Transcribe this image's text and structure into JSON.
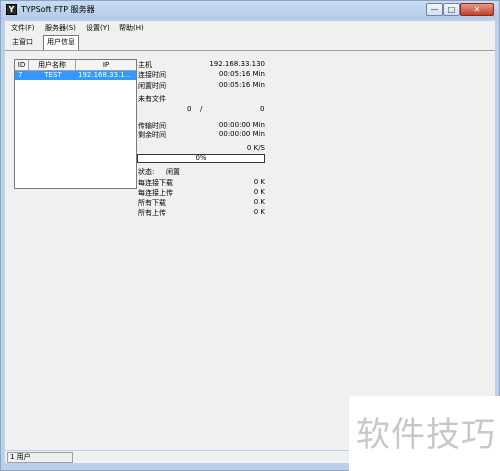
{
  "window": {
    "title": "TYPSoft FTP 服务器"
  },
  "titlebar_buttons": {
    "minimize": "—",
    "maximize": "□",
    "close": "✕"
  },
  "menu": [
    "文件(F)",
    "服务器(S)",
    "设置(Y)",
    "帮助(H)"
  ],
  "tabs": [
    "主窗口",
    "用户信息"
  ],
  "user_list": {
    "columns": [
      "ID",
      "用户名称",
      "IP"
    ],
    "rows": [
      {
        "id": "7",
        "name": "TEST",
        "ip": "192.168.33.1..."
      }
    ]
  },
  "details": {
    "host_label": "主机",
    "host_value": "192.168.33.130",
    "connect_time_label": "连接时间",
    "connect_time_value": "00:05:16 Min",
    "idle_time_label": "闲置时间",
    "idle_time_value": "00:05:16 Min",
    "no_file_label": "未有文件",
    "files_done": "0",
    "files_sep": "/",
    "files_total": "0",
    "transfer_time_label": "传输时间",
    "transfer_time_value": "00:00:00 Min",
    "remaining_time_label": "剩余时间",
    "remaining_time_value": "00:00:00 Min",
    "speed": "0 K/S",
    "progress_text": "0%",
    "progress_value": 0,
    "status_label": "状态:",
    "status_value": "闲置",
    "per_conn_down_label": "每连接下载",
    "per_conn_down_value": "0 K",
    "per_conn_up_label": "每连接上传",
    "per_conn_up_value": "0 K",
    "all_down_label": "所有下载",
    "all_down_value": "0 K",
    "all_up_label": "所有上传",
    "all_up_value": "0 K"
  },
  "statusbar": {
    "users": "1 用户"
  },
  "watermark": "软件技巧",
  "colors": {
    "selection": "#3399ff",
    "frame": "#b9d1ea"
  }
}
